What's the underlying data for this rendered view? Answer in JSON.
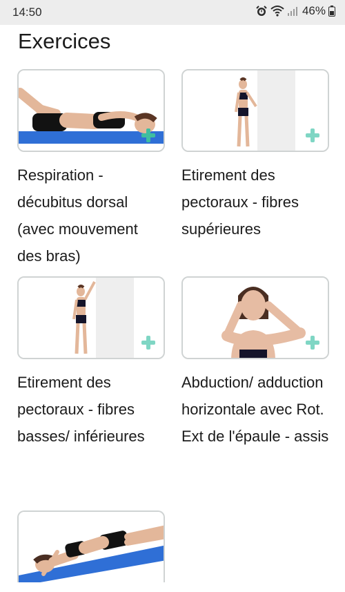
{
  "status": {
    "time": "14:50",
    "battery": "46%",
    "icons": [
      "alarm-icon",
      "wifi-icon",
      "signal-icon",
      "battery-icon"
    ]
  },
  "page": {
    "title": "Exercices"
  },
  "exercises": [
    {
      "title": "Respiration - décubitus dorsal (avec mouvement des bras)",
      "image": "woman-lying-supine"
    },
    {
      "title": "Etirement des pectoraux - fibres supérieures",
      "image": "woman-standing-wall"
    },
    {
      "title": "Etirement des pectoraux - fibres basses/ inférieures",
      "image": "woman-standing-arm-up-wall"
    },
    {
      "title": "Abduction/ adduction horizontale avec Rot. Ext de l'épaule - assis",
      "image": "woman-arms-crossed-head"
    },
    {
      "title": "",
      "image": "woman-lying-on-mat"
    }
  ],
  "colors": {
    "accent": "#7fd6c4",
    "mat": "#2f6fd6",
    "status_bg": "#ededed"
  }
}
